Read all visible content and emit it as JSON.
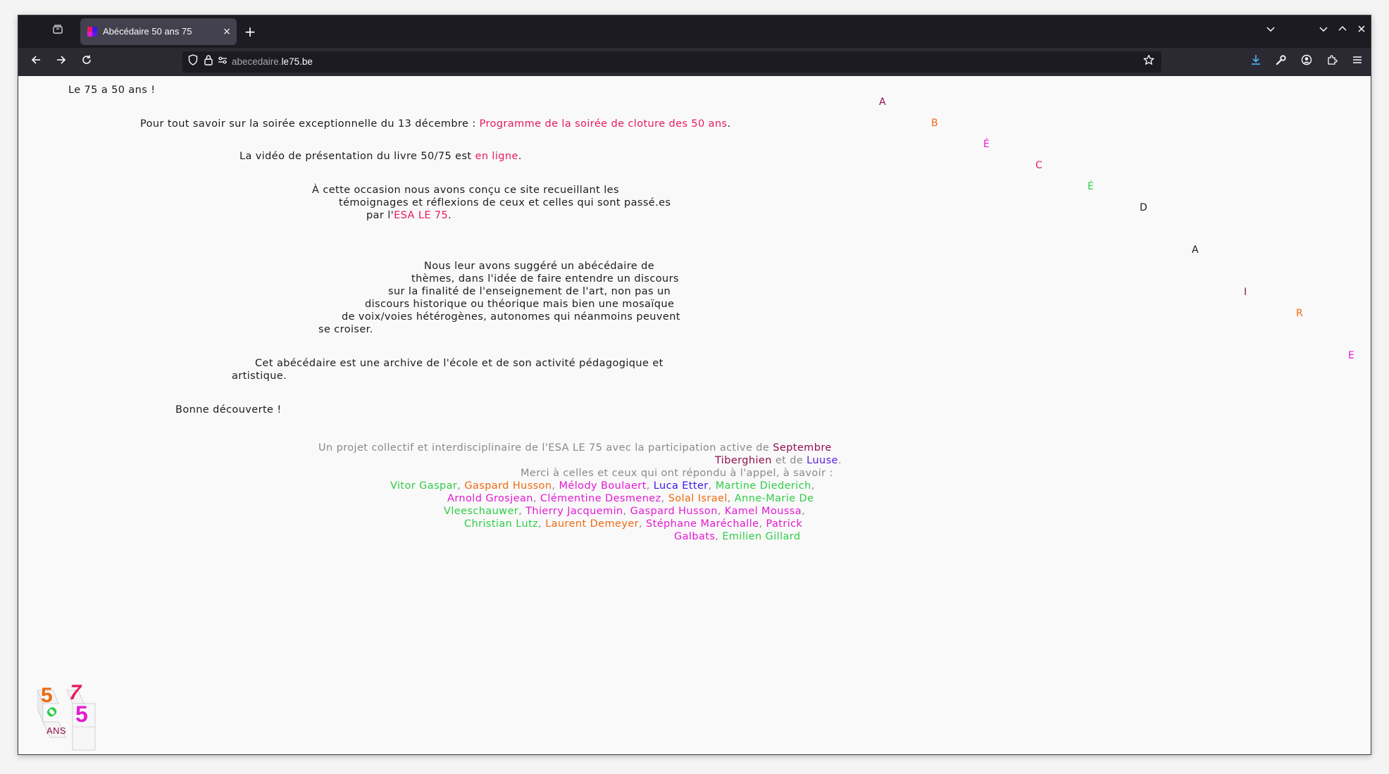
{
  "browser": {
    "tab_title": "Abécédaire 50 ans 75",
    "tab_close": "×",
    "new_tab": "+",
    "url_host_dim": "abecedaire.",
    "url_host": "le75.be"
  },
  "colors": {
    "pink": "#e8195f",
    "plum": "#8e0f4c",
    "purple": "#5b1ee0",
    "green": "#2fcd48",
    "orange": "#ef6a12",
    "magenta": "#e51ad3",
    "blue": "#3b16e8"
  },
  "content": {
    "heading": "Le 75 a 50 ans !",
    "p1_text": "Pour tout savoir sur la soirée exceptionnelle du 13 décembre : ",
    "p1_link": "Programme de la soirée de cloture des 50 ans",
    "p1_end": ".",
    "p2_text": "La vidéo de présentation du livre 50/75 est ",
    "p2_link": "en ligne",
    "p2_end": ".",
    "p3_line1": "À cette occasion nous avons conçu ce site recueillant les",
    "p3_line2": "témoignages et réflexions de ceux et celles qui sont passé.es",
    "p3_line3": "par l'",
    "p3_link": "ESA LE 75",
    "p3_end": ".",
    "p4_line1": "Nous leur avons suggéré un abécédaire de",
    "p4_line2": "thèmes, dans l'idée de faire entendre un discours",
    "p4_line3": "sur la finalité de l'enseignement de l'art, non pas un",
    "p4_line4": "discours historique ou théorique mais bien une mosaïque",
    "p4_line5": "de voix/voies hétérogènes, autonomes qui néanmoins peuvent",
    "p4_line6": "se croiser.",
    "p5_line1": "Cet abécédaire est une archive de l'école et de son activité pédagogique et",
    "p5_line2": "artistique.",
    "p6": "Bonne découverte !"
  },
  "credits": {
    "line1_text": "Un projet collectif et interdisciplinaire de l'ESA LE 75 avec la participation active de ",
    "line1_name": "Septembre",
    "line2_name1": "Tiberghien",
    "line2_and": " et de ",
    "line2_name2": "Luuse",
    "line2_end": ".",
    "line3": "Merci à celles et ceux qui ont répondu à l'appel, à savoir :",
    "names": [
      "Vitor Gaspar",
      "Gaspard Husson",
      "Mélody Boulaert",
      "Luca Etter",
      "Martine Diederich",
      "Arnold Grosjean",
      "Clémentine Desmenez",
      "Solal Israel",
      "Anne-Marie De",
      "Vleeschauwer",
      "Thierry Jacquemin",
      "Gaspard Husson",
      "Kamel Moussa",
      "Christian Lutz",
      "Laurent Demeyer",
      "Stéphane Maréchalle",
      "Patrick",
      "Galbats",
      "Emilien Gillard"
    ],
    "sep": ","
  },
  "abecedaire_letters": [
    "A",
    "B",
    "É",
    "C",
    "É",
    "D",
    "A",
    "I",
    "R",
    "E"
  ],
  "logo": {
    "digit_5": "5",
    "digit_7": "7",
    "digit_0": "0",
    "digit_5b": "5",
    "text": "ANS"
  }
}
